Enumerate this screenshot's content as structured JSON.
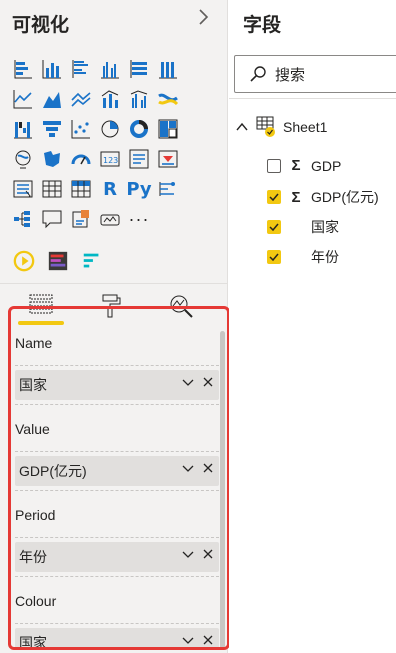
{
  "visualizations": {
    "title": "可视化",
    "collapse_icon": "chevron-right-icon",
    "icons": [
      "stacked-bar-chart-icon",
      "stacked-column-chart-icon",
      "clustered-bar-chart-icon",
      "clustered-column-chart-icon",
      "100-stacked-bar-chart-icon",
      "100-stacked-column-chart-icon",
      "line-chart-icon",
      "area-chart-icon",
      "stacked-area-chart-icon",
      "line-and-column-chart-icon",
      "line-and-clustered-column-chart-icon",
      "ribbon-chart-icon",
      "waterfall-chart-icon",
      "funnel-icon",
      "scatter-chart-icon",
      "pie-chart-icon",
      "donut-chart-icon",
      "treemap-icon",
      "map-icon",
      "filled-map-icon",
      "gauge-icon",
      "card-icon",
      "multi-row-card-icon",
      "kpi-icon",
      "slicer-icon",
      "table-icon",
      "matrix-icon",
      "r-script-icon",
      "python-icon",
      "key-influencers-icon",
      "decomposition-tree-icon",
      "qa-icon",
      "smart-narrative-icon",
      "paginated-report-icon",
      "more-icon"
    ],
    "r_label": "R",
    "py_label": "Py",
    "more_label": "···",
    "custom_visuals": [
      "play-axis-icon",
      "custom-bar-icon",
      "custom-race-icon"
    ]
  },
  "tabs": [
    {
      "icon": "fields-well-icon",
      "active": true
    },
    {
      "icon": "format-paint-roller-icon",
      "active": false
    },
    {
      "icon": "analytics-magnifier-icon",
      "active": false
    }
  ],
  "wells": [
    {
      "label": "Name",
      "value": "国家"
    },
    {
      "label": "Value",
      "value": "GDP(亿元)"
    },
    {
      "label": "Period",
      "value": "年份"
    },
    {
      "label": "Colour",
      "value": "国家"
    }
  ],
  "fields": {
    "title": "字段",
    "search_placeholder": "搜索",
    "table_name": "Sheet1",
    "items": [
      {
        "name": "GDP",
        "checked": false,
        "sigma": true
      },
      {
        "name": "GDP(亿元)",
        "checked": true,
        "sigma": true
      },
      {
        "name": "国家",
        "checked": true,
        "sigma": false
      },
      {
        "name": "年份",
        "checked": true,
        "sigma": false
      }
    ],
    "sigma_symbol": "Σ"
  },
  "colors": {
    "accent_yellow": "#f2c811",
    "highlight_red": "#e53935",
    "chart_blue": "#1a73c8",
    "chart_teal": "#00b7c3"
  }
}
